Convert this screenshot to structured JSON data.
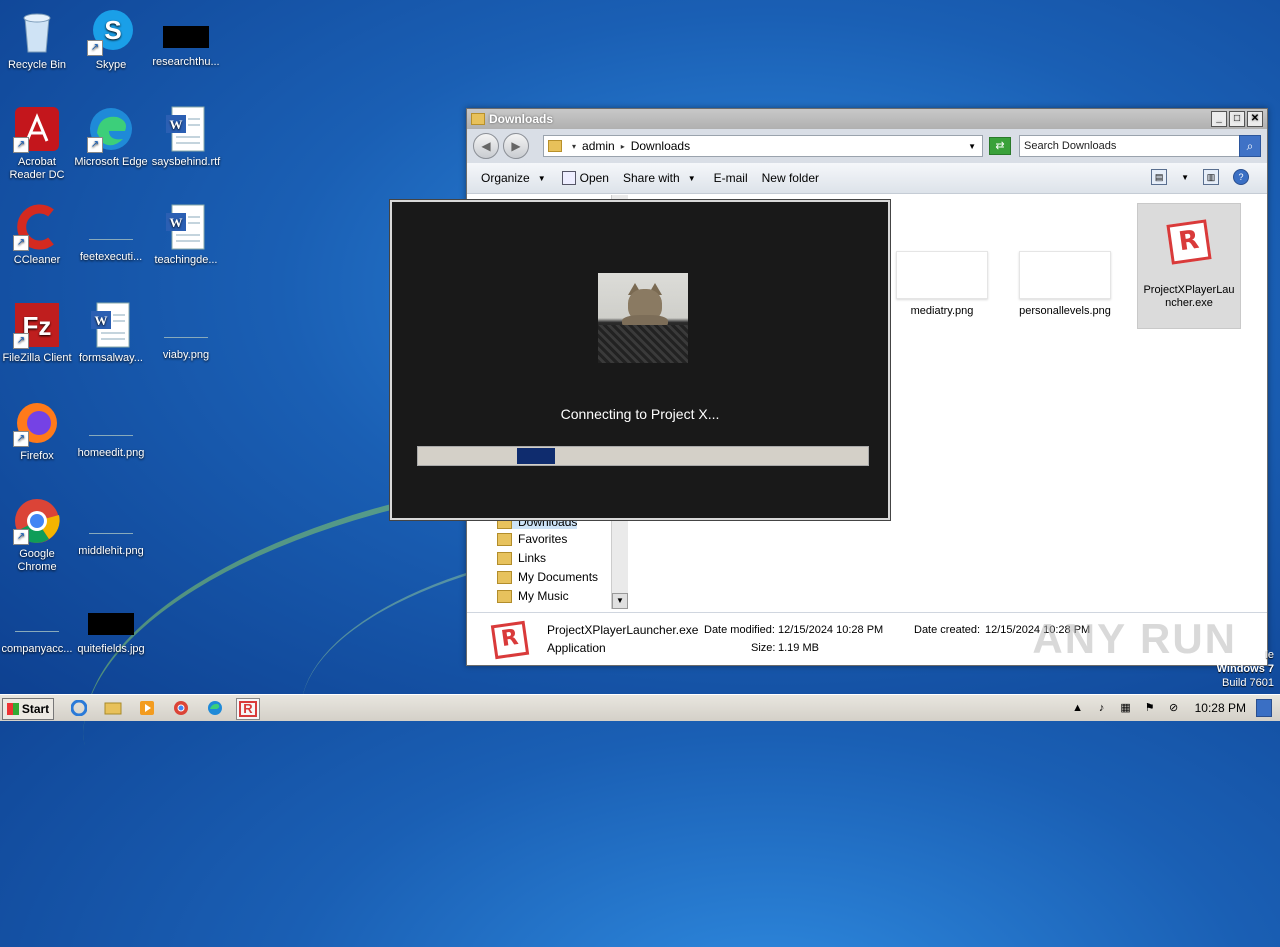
{
  "desktop": {
    "icons": [
      {
        "label": "Recycle Bin",
        "icon": "recycle-bin-icon"
      },
      {
        "label": "Skype",
        "icon": "skype-icon"
      },
      {
        "label": "researchthu...",
        "icon": "black-image-thumb"
      },
      {
        "label": "Acrobat Reader DC",
        "icon": "acrobat-icon"
      },
      {
        "label": "Microsoft Edge",
        "icon": "edge-icon"
      },
      {
        "label": "saysbehind.rtf",
        "icon": "word-doc-icon"
      },
      {
        "label": "CCleaner",
        "icon": "ccleaner-icon"
      },
      {
        "label": "feetexecuti...",
        "icon": "blank-image-thumb"
      },
      {
        "label": "teachingde...",
        "icon": "word-doc-icon"
      },
      {
        "label": "FileZilla Client",
        "icon": "filezilla-icon"
      },
      {
        "label": "formsalway...",
        "icon": "word-doc-icon"
      },
      {
        "label": "viaby.png",
        "icon": "blank-image-thumb"
      },
      {
        "label": "Firefox",
        "icon": "firefox-icon"
      },
      {
        "label": "homeedit.png",
        "icon": "blank-image-thumb"
      },
      {
        "label": "Google Chrome",
        "icon": "chrome-icon"
      },
      {
        "label": "middlehit.png",
        "icon": "blank-image-thumb"
      },
      {
        "label": "companyacc...",
        "icon": "blank-image-thumb"
      },
      {
        "label": "quitefields.jpg",
        "icon": "black-image-thumb"
      }
    ],
    "os_label": {
      "line1": "Windows 7",
      "line2": "Build 7601",
      "partial": "le"
    }
  },
  "explorer": {
    "title": "Downloads",
    "breadcrumb": [
      "admin",
      "Downloads"
    ],
    "search_placeholder": "Search Downloads",
    "toolbar": {
      "organize": "Organize",
      "open": "Open",
      "share_with": "Share with",
      "email": "E-mail",
      "new_folder": "New folder"
    },
    "nav_items": [
      "Downloads",
      "Favorites",
      "Links",
      "My Documents",
      "My Music"
    ],
    "files": [
      {
        "name": "mediatry.png"
      },
      {
        "name": "personallevels.png"
      },
      {
        "name": "ProjectXPlayerLauncher.exe",
        "selected": true
      }
    ],
    "details": {
      "name": "ProjectXPlayerLauncher.exe",
      "type": "Application",
      "modified_label": "Date modified:",
      "modified": "12/15/2024 10:28 PM",
      "size_label": "Size:",
      "size": "1.19 MB",
      "created_label": "Date created:",
      "created": "12/15/2024 10:28 PM"
    },
    "watermark": "ANY RUN"
  },
  "launcher": {
    "status": "Connecting to Project X...",
    "progress_start": 0.22,
    "progress_end": 0.305,
    "progress_color": "#0f2c6e"
  },
  "taskbar": {
    "start_label": "Start",
    "clock": "10:28 PM",
    "items": [
      "ie-icon",
      "explorer-icon",
      "media-player-icon",
      "chrome-icon",
      "edge-icon",
      "roblox-icon"
    ]
  }
}
